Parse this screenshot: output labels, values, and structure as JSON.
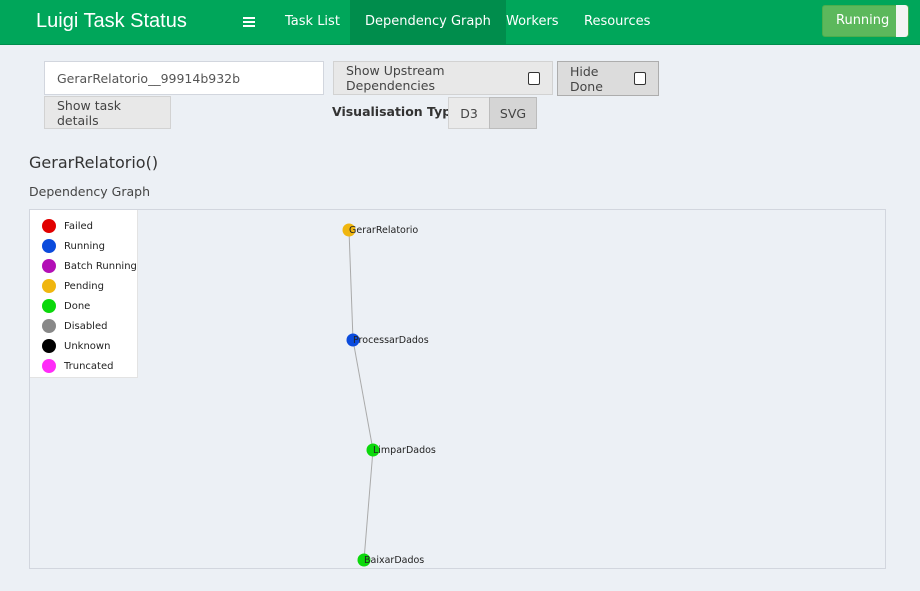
{
  "app": {
    "title": "Luigi Task Status"
  },
  "nav": {
    "items": [
      {
        "label": "Task List"
      },
      {
        "label": "Dependency Graph"
      },
      {
        "label": "Workers"
      },
      {
        "label": "Resources"
      }
    ],
    "active": "Dependency Graph",
    "status_toggle": "Running",
    "menu_icon": "hamburger-icon"
  },
  "controls": {
    "task_id_value": "GerarRelatorio__99914b932b",
    "upstream_label": "Show Upstream Dependencies",
    "upstream_checked": false,
    "hide_done_label": "Hide Done",
    "hide_done_checked": false,
    "details_label": "Show task details",
    "vis_type_label": "Visualisation Type",
    "vis_options": [
      "D3",
      "SVG"
    ],
    "vis_selected": "SVG"
  },
  "task": {
    "title": "GerarRelatorio()",
    "graph_heading": "Dependency Graph"
  },
  "legend": [
    {
      "label": "Failed",
      "color": "#e10000"
    },
    {
      "label": "Running",
      "color": "#0b4bdc"
    },
    {
      "label": "Batch Running",
      "color": "#b30fb6"
    },
    {
      "label": "Pending",
      "color": "#f0b60f"
    },
    {
      "label": "Done",
      "color": "#0bd80b"
    },
    {
      "label": "Disabled",
      "color": "#888888"
    },
    {
      "label": "Unknown",
      "color": "#000000"
    },
    {
      "label": "Truncated",
      "color": "#ff2cf8"
    }
  ],
  "graph": {
    "nodes": [
      {
        "name": "GerarRelatorio",
        "status": "Pending"
      },
      {
        "name": "ProcessarDados",
        "status": "Running"
      },
      {
        "name": "LimparDados",
        "status": "Done"
      },
      {
        "name": "BaixarDados",
        "status": "Done"
      }
    ],
    "edges": [
      [
        "GerarRelatorio",
        "ProcessarDados"
      ],
      [
        "ProcessarDados",
        "LimparDados"
      ],
      [
        "LimparDados",
        "BaixarDados"
      ]
    ]
  }
}
